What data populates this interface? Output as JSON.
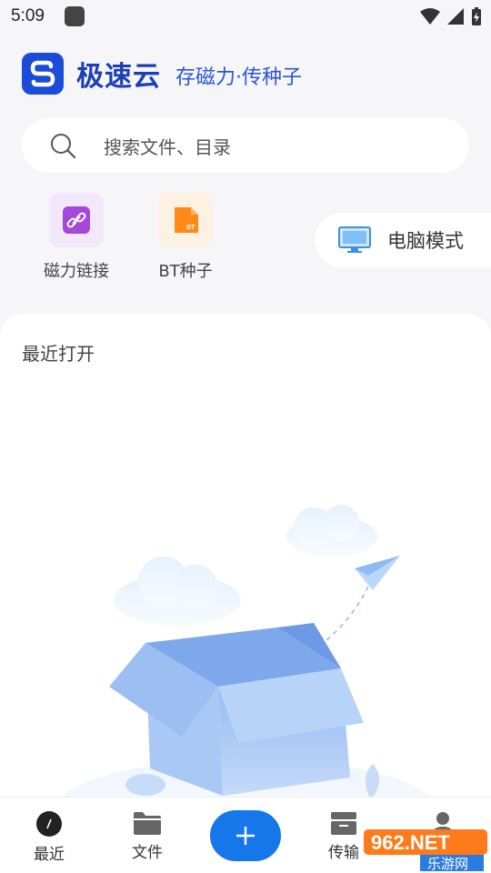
{
  "status": {
    "time": "5:09"
  },
  "header": {
    "app_name": "极速云",
    "slogan": "存磁力·传种子"
  },
  "search": {
    "placeholder": "搜索文件、目录"
  },
  "quick_actions": [
    {
      "label": "磁力链接",
      "icon": "magnet-link-icon",
      "color": "#a348d8"
    },
    {
      "label": "BT种子",
      "icon": "bt-torrent-icon",
      "color": "#ff8a1a"
    }
  ],
  "pc_mode": {
    "label": "电脑模式"
  },
  "recent": {
    "title": "最近打开"
  },
  "nav": {
    "recent": "最近",
    "files": "文件",
    "transfer": "传输"
  },
  "watermark": {
    "brand": "962.NET",
    "sub": "乐游网"
  },
  "colors": {
    "primary": "#1677ea",
    "brand": "#1a4cd8"
  }
}
